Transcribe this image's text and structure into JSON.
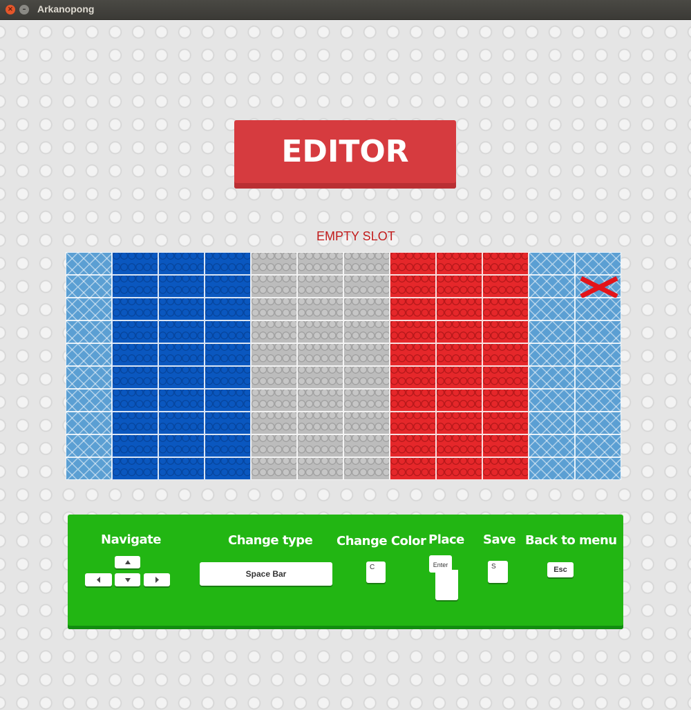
{
  "window": {
    "title": "Arkanopong"
  },
  "header": {
    "title": "EDITOR"
  },
  "status": {
    "slot_label": "EMPTY SLOT"
  },
  "grid": {
    "columns": 12,
    "rows": 10,
    "column_colors": [
      "empty",
      "blue",
      "blue",
      "blue",
      "gray",
      "gray",
      "gray",
      "red",
      "red",
      "red",
      "empty",
      "empty"
    ],
    "cursor": {
      "row": 1,
      "col": 11
    }
  },
  "colors": {
    "empty": "#5b9fd3",
    "blue": "#0a57bf",
    "gray": "#bcbcbc",
    "red": "#e5272a",
    "panel": "#22b613",
    "title_block": "#d63b3f",
    "cursor": "#e3141a"
  },
  "controls": {
    "navigate": {
      "label": "Navigate",
      "keys": [
        "up-arrow-icon",
        "left-arrow-icon",
        "down-arrow-icon",
        "right-arrow-icon"
      ]
    },
    "change_type": {
      "label": "Change type",
      "key": "Space Bar"
    },
    "change_color": {
      "label": "Change Color",
      "key": "C"
    },
    "place": {
      "label": "Place",
      "key": "Enter"
    },
    "save": {
      "label": "Save",
      "key": "S"
    },
    "back": {
      "label": "Back to menu",
      "key": "Esc"
    }
  }
}
